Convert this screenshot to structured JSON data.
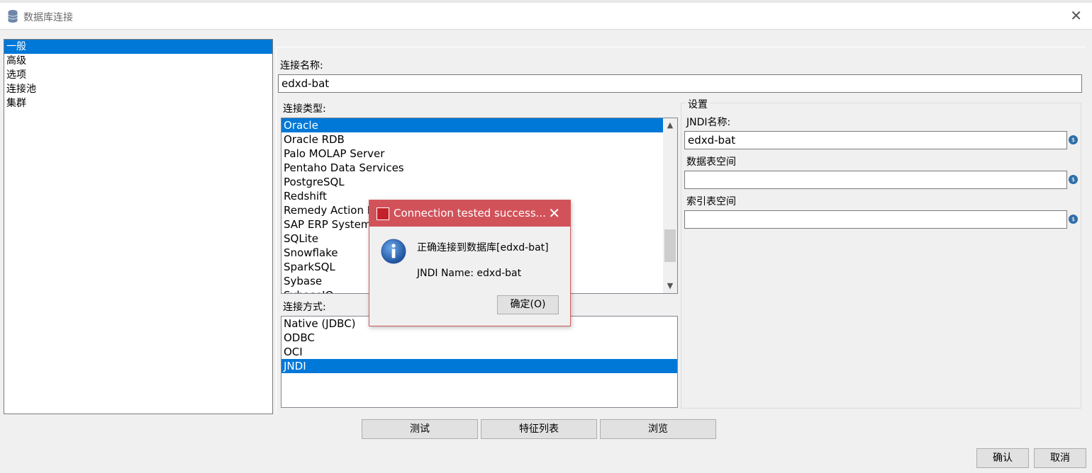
{
  "window": {
    "title": "数据库连接",
    "close_glyph": "✕"
  },
  "nav": {
    "items": [
      {
        "label": "一般",
        "selected": true
      },
      {
        "label": "高级",
        "selected": false
      },
      {
        "label": "选项",
        "selected": false
      },
      {
        "label": "连接池",
        "selected": false
      },
      {
        "label": "集群",
        "selected": false
      }
    ]
  },
  "general": {
    "connection_name_label": "连接名称:",
    "connection_name_value": "edxd-bat",
    "connection_type_label": "连接类型:",
    "connection_types": [
      {
        "label": "Oracle",
        "selected": true
      },
      {
        "label": "Oracle RDB",
        "selected": false
      },
      {
        "label": "Palo MOLAP Server",
        "selected": false
      },
      {
        "label": "Pentaho Data Services",
        "selected": false
      },
      {
        "label": "PostgreSQL",
        "selected": false
      },
      {
        "label": "Redshift",
        "selected": false
      },
      {
        "label": "Remedy Action Request System",
        "selected": false
      },
      {
        "label": "SAP ERP System",
        "selected": false
      },
      {
        "label": "SQLite",
        "selected": false
      },
      {
        "label": "Snowflake",
        "selected": false
      },
      {
        "label": "SparkSQL",
        "selected": false
      },
      {
        "label": "Sybase",
        "selected": false
      },
      {
        "label": "SybaseIQ",
        "selected": false
      }
    ],
    "access_label": "连接方式:",
    "access_methods": [
      {
        "label": "Native (JDBC)",
        "selected": false
      },
      {
        "label": "ODBC",
        "selected": false
      },
      {
        "label": "OCI",
        "selected": false
      },
      {
        "label": "JNDI",
        "selected": true
      }
    ]
  },
  "settings": {
    "legend": "设置",
    "jndi_name_label": "JNDI名称:",
    "jndi_name_value": "edxd-bat",
    "data_tablespace_label": "数据表空间",
    "data_tablespace_value": "",
    "index_tablespace_label": "索引表空间",
    "index_tablespace_value": "",
    "variable_icon": "variable-icon"
  },
  "actions": {
    "test": "测试",
    "feature_list": "特征列表",
    "explore": "浏览"
  },
  "footer": {
    "ok": "确认",
    "cancel": "取消"
  },
  "dialog": {
    "title": "Connection tested success...",
    "message": "正确连接到数据库[edxd-bat]",
    "detail": "JNDI Name: edxd-bat",
    "ok": "确定(O)",
    "icon": "information-icon"
  },
  "colors": {
    "selection": "#0078d7",
    "dialog_title": "#d2525a"
  }
}
